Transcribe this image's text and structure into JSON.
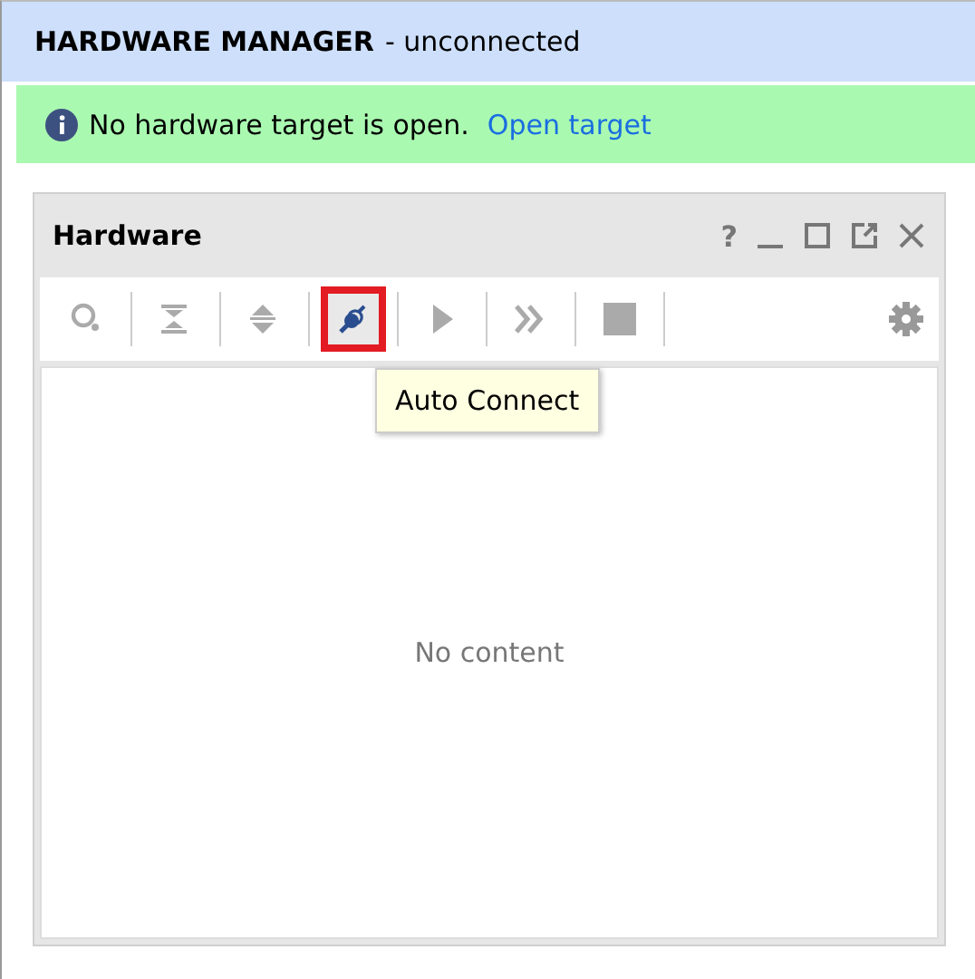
{
  "header": {
    "title": "HARDWARE MANAGER",
    "subtitle": "- unconnected"
  },
  "banner": {
    "message": "No hardware target is open.",
    "link": "Open target"
  },
  "panel": {
    "title": "Hardware",
    "window_controls": [
      "?"
    ],
    "tools": [
      {
        "kind": "search",
        "disabled": true,
        "highlighted": false
      },
      {
        "kind": "collapse",
        "disabled": true,
        "highlighted": false
      },
      {
        "kind": "expand",
        "disabled": true,
        "highlighted": false
      },
      {
        "kind": "connect",
        "disabled": false,
        "highlighted": true
      },
      {
        "kind": "play",
        "disabled": true,
        "highlighted": false
      },
      {
        "kind": "forward",
        "disabled": true,
        "highlighted": false
      },
      {
        "kind": "stop",
        "disabled": true,
        "highlighted": false
      }
    ],
    "tooltip": "Auto Connect",
    "empty_text": "No content"
  }
}
